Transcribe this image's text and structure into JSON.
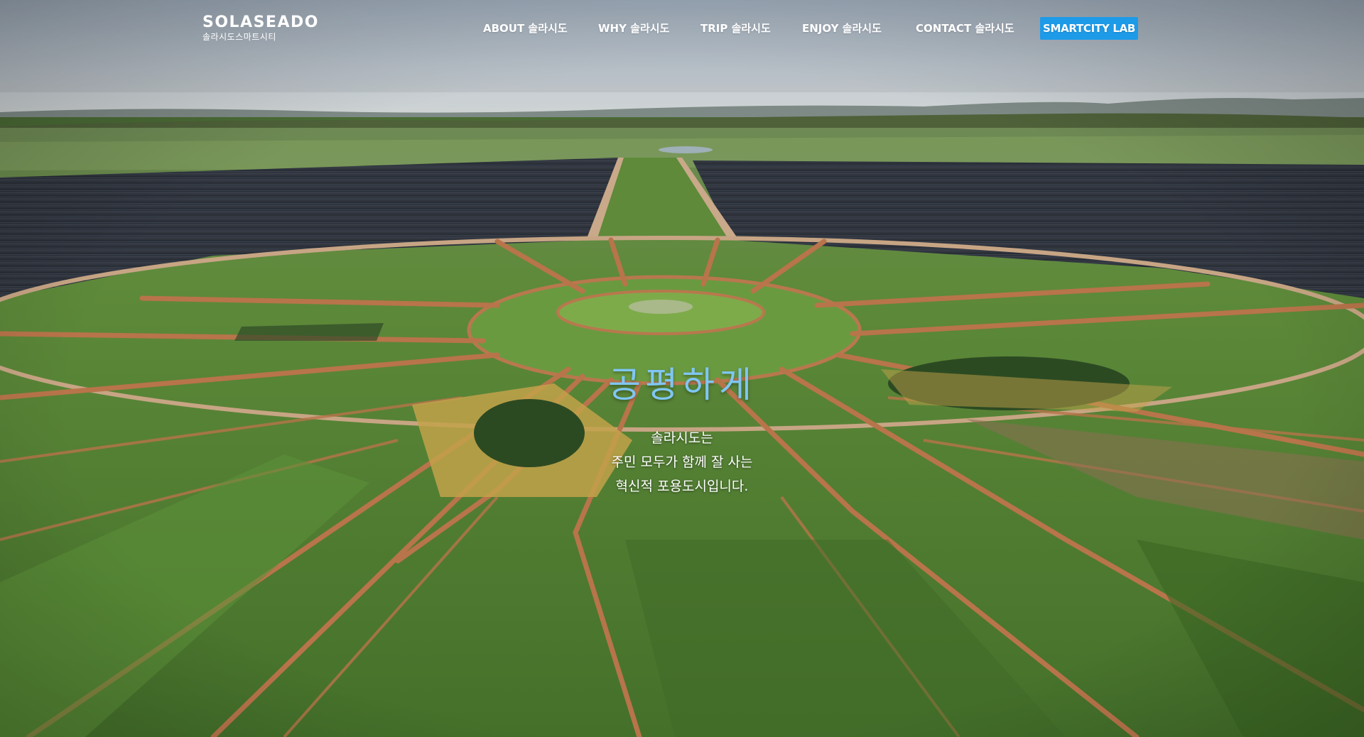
{
  "brand": {
    "name": "SOLASEADO",
    "subtitle": "솔라시도스마트시티"
  },
  "nav": {
    "items": [
      {
        "label": "ABOUT 솔라시도"
      },
      {
        "label": "WHY 솔라시도"
      },
      {
        "label": "TRIP 솔라시도"
      },
      {
        "label": "ENJOY 솔라시도"
      },
      {
        "label": "CONTACT 솔라시도"
      }
    ],
    "cta_label": "SMARTCITY LAB"
  },
  "hero": {
    "title": "공평하게",
    "lines": [
      "솔라시도는",
      "주민 모두가 함께 잘 사는",
      "혁신적 포용도시입니다."
    ]
  },
  "colors": {
    "cta_bg": "#1e9be8",
    "title": "#7fc6f2",
    "sky": "#b9c6d2",
    "field_green": "#4f7a2f",
    "dirt_path": "#b9764a",
    "solar_panel": "#2a2f3a"
  }
}
